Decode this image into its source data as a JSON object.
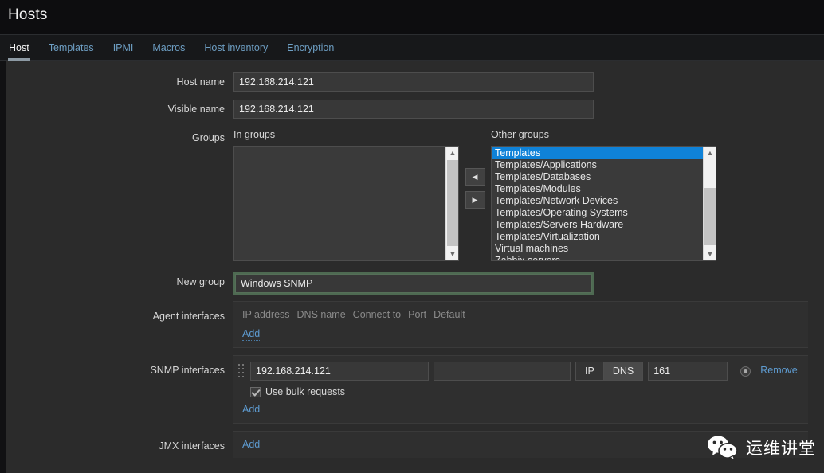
{
  "header": {
    "title": "Hosts"
  },
  "tabs": [
    {
      "label": "Host",
      "active": true
    },
    {
      "label": "Templates",
      "active": false
    },
    {
      "label": "IPMI",
      "active": false
    },
    {
      "label": "Macros",
      "active": false
    },
    {
      "label": "Host inventory",
      "active": false
    },
    {
      "label": "Encryption",
      "active": false
    }
  ],
  "form": {
    "host_name": {
      "label": "Host name",
      "value": "192.168.214.121"
    },
    "visible_name": {
      "label": "Visible name",
      "value": "192.168.214.121"
    },
    "groups": {
      "label": "Groups",
      "in_groups_caption": "In groups",
      "other_groups_caption": "Other groups",
      "in_groups": [],
      "other_groups": [
        "Templates",
        "Templates/Applications",
        "Templates/Databases",
        "Templates/Modules",
        "Templates/Network Devices",
        "Templates/Operating Systems",
        "Templates/Servers Hardware",
        "Templates/Virtualization",
        "Virtual machines",
        "Zabbix servers"
      ],
      "selected_other_group": "Templates",
      "move_left_icon": "arrow-left-icon",
      "move_right_icon": "arrow-right-icon"
    },
    "new_group": {
      "label": "New group",
      "value": "Windows SNMP",
      "focused": true
    },
    "agent_interfaces": {
      "label": "Agent interfaces",
      "columns": [
        "IP address",
        "DNS name",
        "Connect to",
        "Port",
        "Default"
      ],
      "add_label": "Add",
      "rows": []
    },
    "snmp_interfaces": {
      "label": "SNMP interfaces",
      "add_label": "Add",
      "remove_label": "Remove",
      "rows": [
        {
          "drag_icon": "drag-handle-icon",
          "ip": "192.168.214.121",
          "dns": "",
          "connect_to": "IP",
          "connect_options": [
            "IP",
            "DNS"
          ],
          "port": "161",
          "default_selected": true
        }
      ],
      "bulk": {
        "label": "Use bulk requests",
        "checked": true
      }
    },
    "jmx_interfaces": {
      "label": "JMX interfaces",
      "add_label": "Add"
    }
  },
  "placeholders": {
    "dns_empty": ""
  },
  "watermark": {
    "text": "运维讲堂",
    "icon": "wechat-icon"
  },
  "colors": {
    "accent_selected": "#0f82d8",
    "link": "#5e9bd0",
    "focus_border": "#4e6a52",
    "panel_bg": "#2b2b2b"
  }
}
